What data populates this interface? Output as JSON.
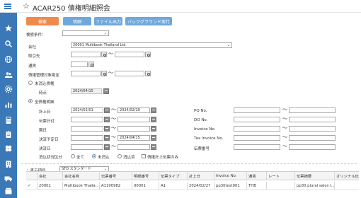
{
  "header": {
    "title": "ACAR250 債権明細照会",
    "star_icon": "star-icon",
    "menu_icon": "hamburger-icon"
  },
  "theme": {
    "sidebar": "#3a78b8",
    "active_tab": "#f08a4b",
    "tab": "#6ea8dc"
  },
  "sidebar": {
    "icons": [
      "star-icon",
      "search-icon",
      "globe-icon",
      "people-icon",
      "settings-icon",
      "chart-icon",
      "calculator-icon",
      "clipboard-icon",
      "clover-icon",
      "building-icon",
      "truck-icon",
      "box-icon"
    ]
  },
  "tabs": [
    "検索",
    "明細",
    "ファイル出力",
    "バックグラウンド実行"
  ],
  "form": {
    "search_condition_label": "検索条件：",
    "company_label": "会社",
    "company_value": "20001 Multibook Thailand Ltd",
    "customer_label": "取引先",
    "currency_label": "通貨",
    "claim_mgmt_label": "債権管理対象勘定",
    "unreconciled_label": "未消込債権",
    "as_of_label": "時点",
    "as_of_value": "2024/04/15",
    "all_claims_label": "全債権明細",
    "posting_date_label": "計上日",
    "posting_date_from": "2024/02/01",
    "posting_date_to": "2024/02/29",
    "voucher_date_label": "伝票日付",
    "due_date_label": "期日",
    "settlement_plan_label": "決済予定日",
    "settlement_plan_to": "2024/04/15",
    "settlement_date_label": "決済日",
    "recon_class_label": "消込状況区分",
    "recon_all": "全て",
    "recon_unreconciled": "未消込",
    "recon_reconciled": "消込済",
    "posted_only_label": "債権計上伝票のみ",
    "po_label": "PO No.",
    "do_label": "DO No.",
    "invoice_label": "Invoice No.",
    "tax_invoice_label": "Tax Invoice No.",
    "voucher_no_label": "伝票番号",
    "tilde": "～"
  },
  "display": {
    "label": "：表示項目",
    "selected": "STD スタンダード"
  },
  "table": {
    "headers": [
      "会社",
      "会社名称",
      "伝票番号",
      "明細番号",
      "伝票タイプ",
      "計上日",
      "Invoice No.",
      "通貨",
      "レート",
      "伝票摘要",
      "オリジナル伝"
    ],
    "rows": [
      [
        "20001",
        "Multibook Thaila...",
        "A1100982",
        "00001",
        "A1",
        "2024/02/27",
        "pp30test001",
        "THB",
        "",
        "pp30 plural sales i...",
        ""
      ]
    ]
  }
}
